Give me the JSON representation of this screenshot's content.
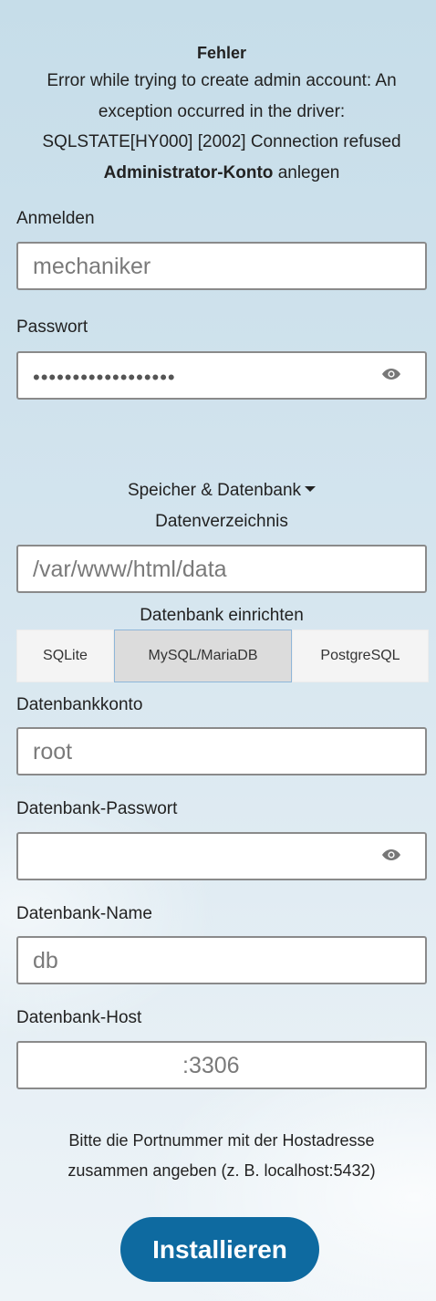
{
  "error": {
    "title": "Fehler",
    "message_line1": "Error while trying to create admin account: An",
    "message_line2": "exception occurred in the driver:",
    "message_line3": "SQLSTATE[HY000] [2002] Connection refused",
    "create_bold": "Administrator-Konto",
    "create_rest": " anlegen"
  },
  "admin": {
    "login_label": "Anmelden",
    "login_value": "mechaniker",
    "password_label": "Passwort",
    "password_value": "••••••••••••••••••"
  },
  "storage": {
    "toggle_label": "Speicher & Datenbank",
    "data_dir_label": "Datenverzeichnis",
    "data_dir_value": "/var/www/html/data",
    "db_setup_label": "Datenbank einrichten",
    "db_tabs": [
      "SQLite",
      "MySQL/MariaDB",
      "PostgreSQL"
    ],
    "selected_tab": "MySQL/MariaDB"
  },
  "database": {
    "account_label": "Datenbankkonto",
    "account_value": "root",
    "password_label": "Datenbank-Passwort",
    "password_value": "",
    "name_label": "Datenbank-Name",
    "name_value": "db",
    "host_label": "Datenbank-Host",
    "host_value": ":3306",
    "hint_line1": "Bitte die Portnummer mit der Hostadresse",
    "hint_line2": "zusammen angeben (z. B. localhost:5432)"
  },
  "install_button": "Installieren",
  "colors": {
    "primary": "#0e6aa0",
    "selected_tab": "#dcdcdc"
  },
  "icons": {
    "password_toggle": "eye-icon",
    "storage_toggle": "caret-down-icon"
  }
}
